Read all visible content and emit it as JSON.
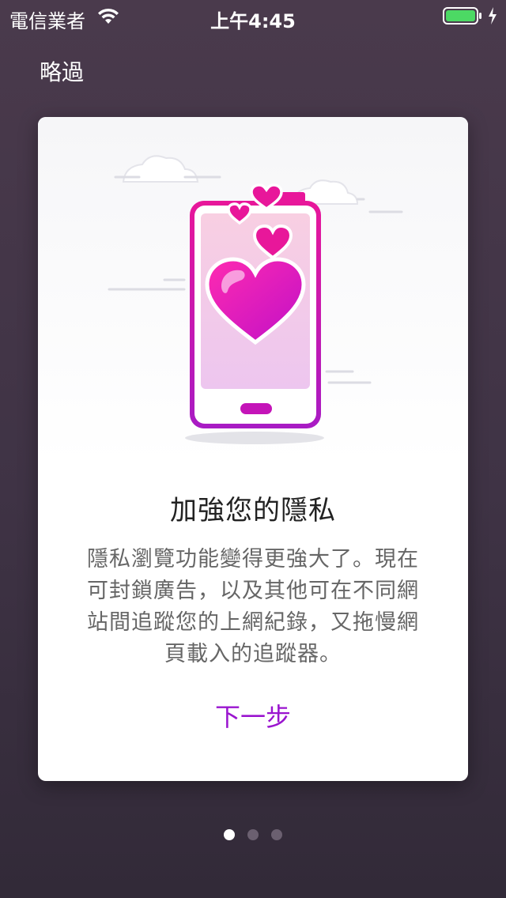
{
  "status_bar": {
    "carrier": "電信業者",
    "time": "上午4:45",
    "battery_color": "#4cd964"
  },
  "skip_label": "略過",
  "card": {
    "title": "加強您的隱私",
    "body": "隱私瀏覽功能變得更強大了。現在可封鎖廣告，以及其他可在不同網站間追蹤您的上網紀錄，又拖慢網頁載入的追蹤器。",
    "next_label": "下一步",
    "illustration": "phone-with-hearts",
    "accent_color": "#9a14cf"
  },
  "pager": {
    "total": 3,
    "active_index": 0
  }
}
